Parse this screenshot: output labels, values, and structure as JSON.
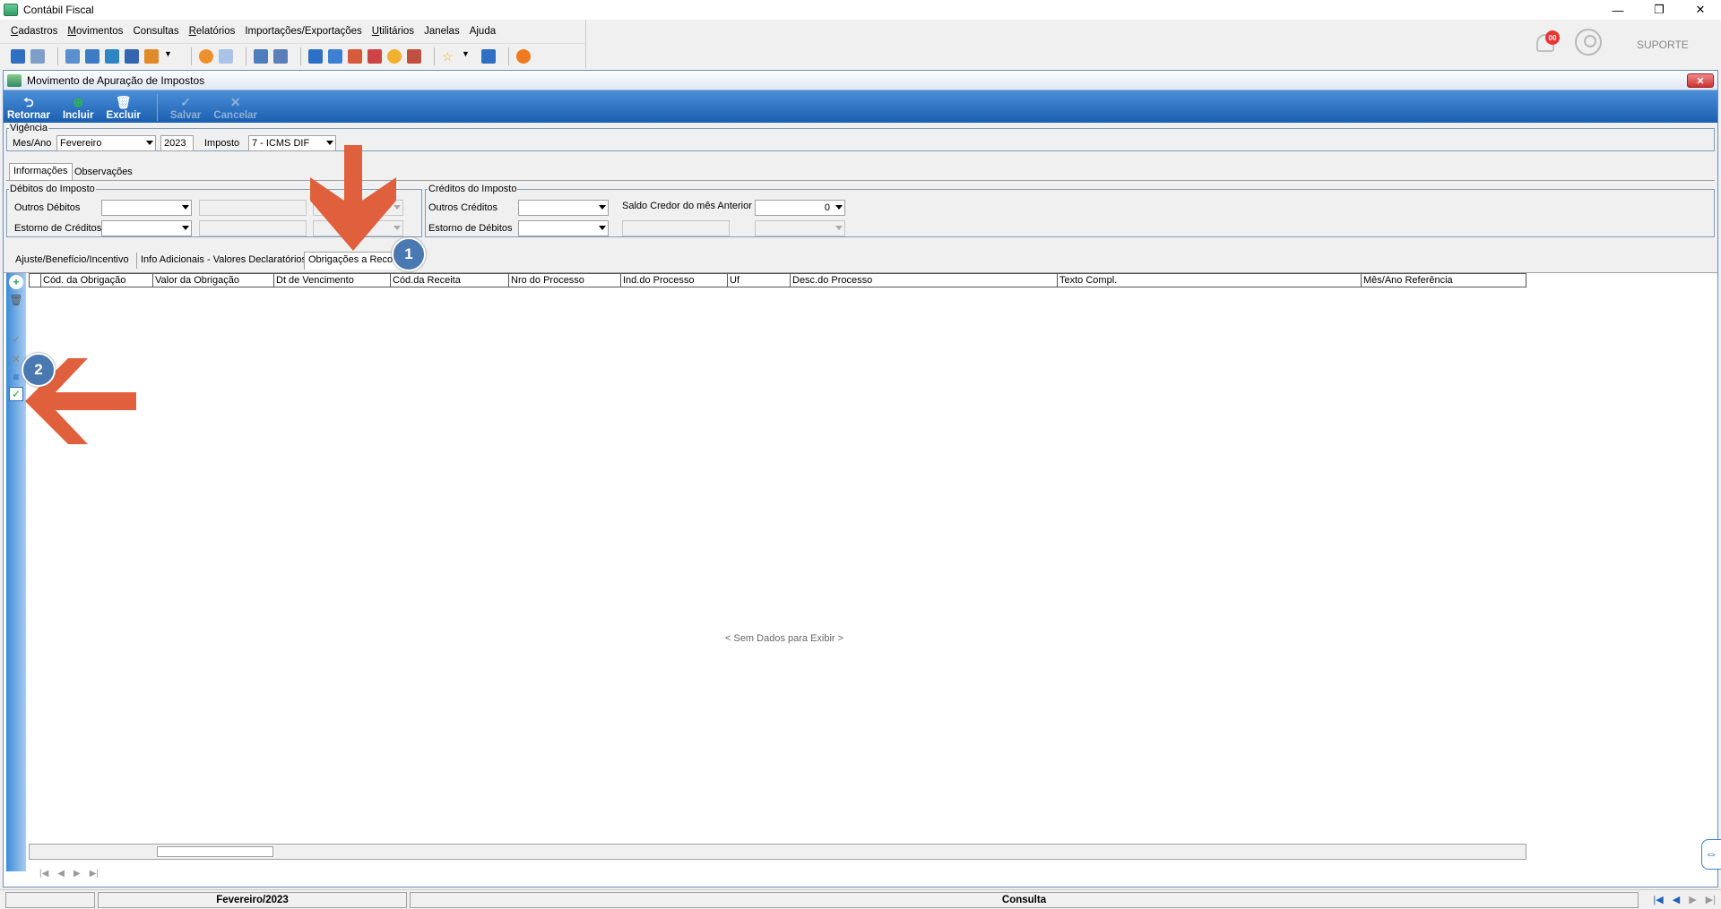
{
  "window": {
    "title": "Contábil Fiscal",
    "controls": [
      "—",
      "❐",
      "✕"
    ]
  },
  "menu": {
    "items": [
      {
        "label": "Cadastros",
        "u": "C",
        "rest": "adastros"
      },
      {
        "label": "Movimentos",
        "u": "M",
        "rest": "ovimentos"
      },
      {
        "label": "Consultas",
        "u": "",
        "rest": "Consultas"
      },
      {
        "label": "Relatórios",
        "u": "R",
        "rest": "elatórios"
      },
      {
        "label": "Importações/Exportações",
        "u": "",
        "rest": "Importações/Exportações"
      },
      {
        "label": "Utilitários",
        "u": "U",
        "rest": "tilitários"
      },
      {
        "label": "Janelas",
        "u": "",
        "rest": "Janelas"
      },
      {
        "label": "Ajuda",
        "u": "",
        "rest": "Ajuda"
      }
    ]
  },
  "topright": {
    "notif_count": "00",
    "user_label": "SUPORTE"
  },
  "form": {
    "title": "Movimento de Apuração de Impostos",
    "close": "✕",
    "actions": {
      "retornar": "Retornar",
      "incluir": "Incluir",
      "excluir": "Excluir",
      "salvar": "Salvar",
      "cancelar": "Cancelar"
    },
    "vigencia": {
      "legend": "Vigência",
      "mesano_label": "Mes/Ano",
      "mes_value": "Fevereiro",
      "ano_value": "2023",
      "imposto_label": "Imposto",
      "imposto_value": "7 - ICMS DIF"
    },
    "tabs": {
      "informacoes": "Informações",
      "observacoes": "Observações"
    },
    "debitos": {
      "legend": "Débitos do Imposto",
      "outros_debitos": "Outros Débitos",
      "estorno_creditos": "Estorno de Créditos"
    },
    "creditos": {
      "legend": "Créditos do Imposto",
      "outros_creditos": "Outros Créditos",
      "estorno_debitos": "Estorno de Débitos",
      "saldo_label": "Saldo Credor do mês Anterior",
      "saldo_value": "0"
    },
    "subtabs": {
      "ajuste": "Ajuste/Benefício/Incentivo",
      "info_adicionais": "Info Adicionais - Valores Declaratórios",
      "obrigacoes": "Obrigações a Recolher"
    },
    "grid": {
      "columns": [
        "Cód. da Obrigação",
        "Valor da Obrigação",
        "Dt de Vencimento",
        "Cód.da Receita",
        "Nro do Processo",
        "Ind.do Processo",
        "Uf",
        "Desc.do Processo",
        "Texto Compl.",
        "Mês/Ano Referência"
      ],
      "no_data": "< Sem Dados para Exibir >"
    }
  },
  "annotations": {
    "step1": "1",
    "step2": "2",
    "arrow_color": "#e0603d",
    "circle_color": "#4a78b0"
  },
  "status": {
    "periodo": "Fevereiro/2023",
    "modo": "Consulta"
  }
}
